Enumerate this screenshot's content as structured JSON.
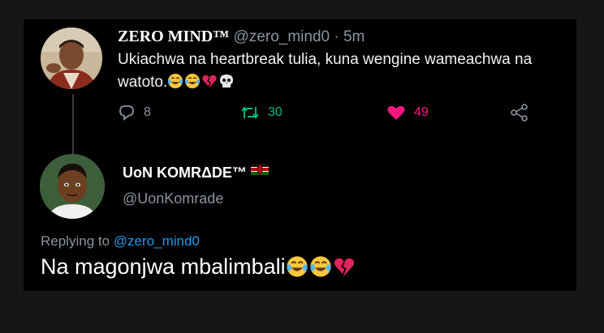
{
  "tweet": {
    "author": {
      "name": "ZERO MIND™",
      "handle": "@zero_mind0",
      "time": "5m"
    },
    "separator": "·",
    "text": "Ukiachwa na heartbreak tulia, kuna wengine wameachwa na watoto.",
    "emojis": [
      "tears-of-joy-emoji",
      "tears-of-joy-emoji",
      "broken-heart-emoji",
      "skull-emoji"
    ],
    "actions": {
      "replies": "8",
      "retweets": "30",
      "likes": "49"
    },
    "colors": {
      "retweet": "#00ba7c",
      "like": "#f91880",
      "muted": "#8b949e",
      "link": "#1d9bf0"
    }
  },
  "reply": {
    "author": {
      "name": "UoN KOMRΔDE™",
      "handle": "@UonKomrade",
      "flag": "kenya-flag-emoji"
    },
    "replying_label": "Replying to",
    "replying_to": "@zero_mind0",
    "text": "Na magonjwa mbalimbali",
    "emojis": [
      "tears-of-joy-emoji",
      "tears-of-joy-emoji",
      "broken-heart-emoji"
    ]
  }
}
